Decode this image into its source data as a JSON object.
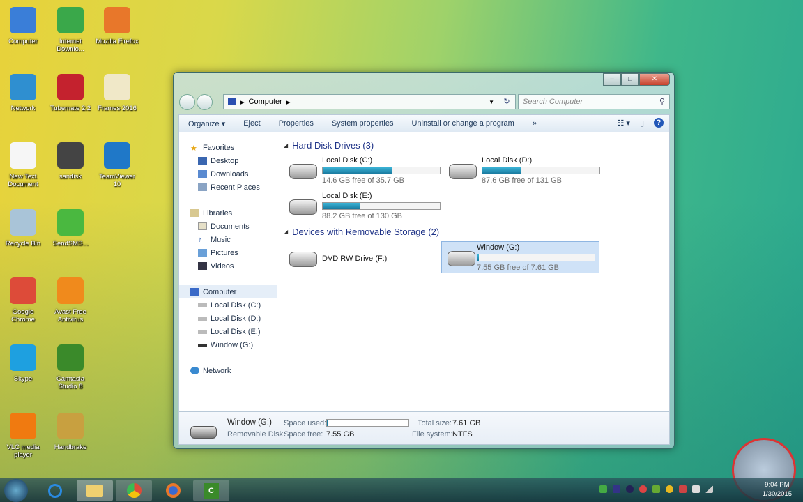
{
  "desktop": {
    "icons": [
      {
        "label": "Computer",
        "color": "#3a7ed8"
      },
      {
        "label": "Internet Downlo...",
        "color": "#3aa84a"
      },
      {
        "label": "Mozilla Firefox",
        "color": "#e8772a"
      },
      {
        "label": "Network",
        "color": "#2f8fd0"
      },
      {
        "label": "Tubemate 2.2",
        "color": "#c4222e"
      },
      {
        "label": "Frames 2016",
        "color": "#f0e8c8"
      },
      {
        "label": "New Text Document",
        "color": "#f6f6f6"
      },
      {
        "label": "sandisk",
        "color": "#444444"
      },
      {
        "label": "TeamViewer 10",
        "color": "#1f78c8"
      },
      {
        "label": "Recycle Bin",
        "color": "#a9c4d8"
      },
      {
        "label": "SendSMS...",
        "color": "#4ab840"
      },
      {
        "label": "Google Chrome",
        "color": "#dd4b39"
      },
      {
        "label": "Avast Free Antivirus",
        "color": "#f08a1c"
      },
      {
        "label": "Skype",
        "color": "#1ea0e0"
      },
      {
        "label": "Camtasia Studio 8",
        "color": "#3a8a2a"
      },
      {
        "label": "VLC media player",
        "color": "#f07a10"
      },
      {
        "label": "Handbrake",
        "color": "#c8a040"
      }
    ]
  },
  "window": {
    "address": "Computer",
    "search_placeholder": "Search Computer",
    "toolbar": [
      "Organize ▾",
      "Eject",
      "Properties",
      "System properties",
      "Uninstall or change a program",
      "»"
    ],
    "nav": {
      "favorites": "Favorites",
      "fav_items": [
        "Desktop",
        "Downloads",
        "Recent Places"
      ],
      "libraries": "Libraries",
      "lib_items": [
        "Documents",
        "Music",
        "Pictures",
        "Videos"
      ],
      "computer": "Computer",
      "comp_items": [
        "Local Disk (C:)",
        "Local Disk (D:)",
        "Local Disk (E:)",
        "Window  (G:)"
      ],
      "network": "Network"
    },
    "groups": {
      "hdd": "Hard Disk Drives (3)",
      "removable": "Devices with Removable Storage (2)"
    },
    "drives": [
      {
        "name": "Local Disk (C:)",
        "free": "14.6 GB free of 35.7 GB",
        "used_fraction": 0.59
      },
      {
        "name": "Local Disk (D:)",
        "free": "87.6 GB free of 131 GB",
        "used_fraction": 0.33
      },
      {
        "name": "Local Disk (E:)",
        "free": "88.2 GB free of 130 GB",
        "used_fraction": 0.32
      },
      {
        "name": "DVD RW Drive (F:)"
      },
      {
        "name": "Window  (G:)",
        "free": "7.55 GB free of 7.61 GB",
        "used_fraction": 0.01
      }
    ],
    "details": {
      "name": "Window  (G:)",
      "type": "Removable Disk",
      "space_used_label": "Space used:",
      "space_free_label": "Space free:",
      "space_free": "7.55 GB",
      "total_label": "Total size:",
      "total": "7.61 GB",
      "fs_label": "File system:",
      "fs": "NTFS",
      "used_fraction": 0.01
    }
  },
  "taskbar": {
    "time": "9:04 PM",
    "date": "1/30/2015"
  }
}
